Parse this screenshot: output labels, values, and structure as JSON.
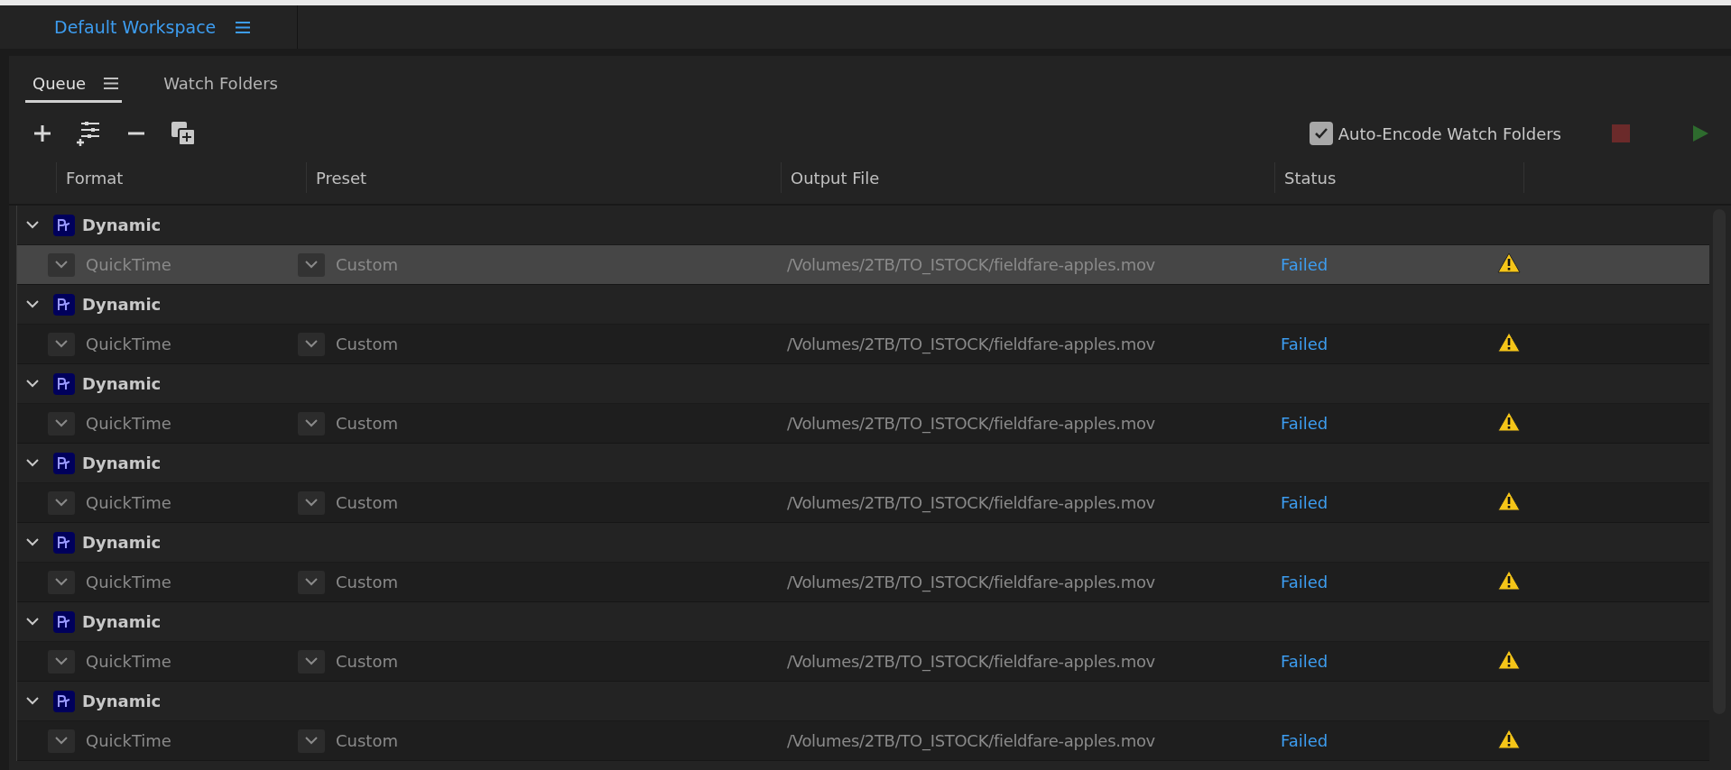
{
  "workspace": {
    "title": "Default Workspace"
  },
  "tabs": [
    {
      "label": "Queue",
      "selected": true,
      "menu": true
    },
    {
      "label": "Watch Folders",
      "selected": false,
      "menu": false
    }
  ],
  "auto_encode": {
    "label": "Auto-Encode Watch Folders",
    "checked": true
  },
  "table": {
    "columns": [
      "Format",
      "Preset",
      "Output File",
      "Status"
    ],
    "groups": [
      {
        "name": "Dynamic",
        "expanded": true,
        "items": [
          {
            "format": "QuickTime",
            "preset": "Custom",
            "output": "/Volumes/2TB/TO_ISTOCK/fieldfare-apples.mov",
            "status": "Failed",
            "warning": true,
            "selected": true
          }
        ]
      },
      {
        "name": "Dynamic",
        "expanded": true,
        "items": [
          {
            "format": "QuickTime",
            "preset": "Custom",
            "output": "/Volumes/2TB/TO_ISTOCK/fieldfare-apples.mov",
            "status": "Failed",
            "warning": true,
            "selected": false
          }
        ]
      },
      {
        "name": "Dynamic",
        "expanded": true,
        "items": [
          {
            "format": "QuickTime",
            "preset": "Custom",
            "output": "/Volumes/2TB/TO_ISTOCK/fieldfare-apples.mov",
            "status": "Failed",
            "warning": true,
            "selected": false
          }
        ]
      },
      {
        "name": "Dynamic",
        "expanded": true,
        "items": [
          {
            "format": "QuickTime",
            "preset": "Custom",
            "output": "/Volumes/2TB/TO_ISTOCK/fieldfare-apples.mov",
            "status": "Failed",
            "warning": true,
            "selected": false
          }
        ]
      },
      {
        "name": "Dynamic",
        "expanded": true,
        "items": [
          {
            "format": "QuickTime",
            "preset": "Custom",
            "output": "/Volumes/2TB/TO_ISTOCK/fieldfare-apples.mov",
            "status": "Failed",
            "warning": true,
            "selected": false
          }
        ]
      },
      {
        "name": "Dynamic",
        "expanded": true,
        "items": [
          {
            "format": "QuickTime",
            "preset": "Custom",
            "output": "/Volumes/2TB/TO_ISTOCK/fieldfare-apples.mov",
            "status": "Failed",
            "warning": true,
            "selected": false
          }
        ]
      },
      {
        "name": "Dynamic",
        "expanded": true,
        "items": [
          {
            "format": "QuickTime",
            "preset": "Custom",
            "output": "/Volumes/2TB/TO_ISTOCK/fieldfare-apples.mov",
            "status": "Failed",
            "warning": true,
            "selected": false
          }
        ]
      }
    ]
  }
}
